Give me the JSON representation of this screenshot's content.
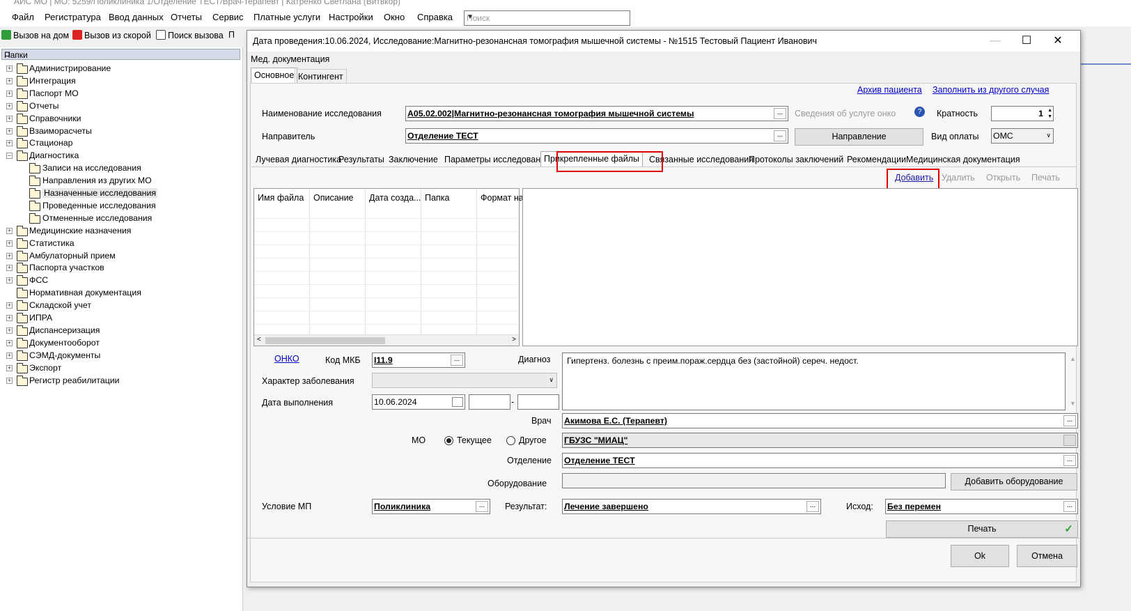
{
  "app": {
    "title": "АИС МО | МО: 5259/Поликлиника 1/Отделение ТЕСТ/Врач-терапевт | Катренко Светлана (Витвкор)"
  },
  "menu": [
    "Файл",
    "Регистратура",
    "Ввод данных",
    "Отчеты",
    "Сервис",
    "Платные услуги",
    "Настройки",
    "Окно",
    "Справка"
  ],
  "search": {
    "placeholder": "Поиск"
  },
  "toolbar": {
    "home_call": "Вызов на дом",
    "ambulance_call": "Вызов из скорой",
    "search_call": "Поиск вызова",
    "extra": "П"
  },
  "panel": {
    "title": "Папки",
    "pin": "⊐"
  },
  "tree": [
    {
      "label": "Администрирование",
      "level": 0,
      "exp": "+"
    },
    {
      "label": "Интеграция",
      "level": 0,
      "exp": "+"
    },
    {
      "label": "Паспорт МО",
      "level": 0,
      "exp": "+"
    },
    {
      "label": "Отчеты",
      "level": 0,
      "exp": "+"
    },
    {
      "label": "Справочники",
      "level": 0,
      "exp": "+"
    },
    {
      "label": "Взаиморасчеты",
      "level": 0,
      "exp": "+"
    },
    {
      "label": "Стационар",
      "level": 0,
      "exp": "+"
    },
    {
      "label": "Диагностика",
      "level": 0,
      "exp": "−"
    },
    {
      "label": "Записи на исследования",
      "level": 1,
      "exp": ""
    },
    {
      "label": "Направления из других МО",
      "level": 1,
      "exp": ""
    },
    {
      "label": "Назначенные исследования",
      "level": 1,
      "exp": "",
      "selected": true
    },
    {
      "label": "Проведенные исследования",
      "level": 1,
      "exp": ""
    },
    {
      "label": "Отмененные исследования",
      "level": 1,
      "exp": ""
    },
    {
      "label": "Медицинские назначения",
      "level": 0,
      "exp": "+"
    },
    {
      "label": "Статистика",
      "level": 0,
      "exp": "+"
    },
    {
      "label": "Амбулаторный прием",
      "level": 0,
      "exp": "+"
    },
    {
      "label": "Паспорта участков",
      "level": 0,
      "exp": "+"
    },
    {
      "label": "ФСС",
      "level": 0,
      "exp": "+"
    },
    {
      "label": "Нормативная документация",
      "level": 0,
      "exp": ""
    },
    {
      "label": "Складской учет",
      "level": 0,
      "exp": "+"
    },
    {
      "label": "ИПРА",
      "level": 0,
      "exp": "+"
    },
    {
      "label": "Диспансеризация",
      "level": 0,
      "exp": "+"
    },
    {
      "label": "Документооборот",
      "level": 0,
      "exp": "+"
    },
    {
      "label": "СЭМД-документы",
      "level": 0,
      "exp": "+"
    },
    {
      "label": "Экспорт",
      "level": 0,
      "exp": "+"
    },
    {
      "label": "Регистр реабилитации",
      "level": 0,
      "exp": "+"
    }
  ],
  "dialog": {
    "title": "Дата проведения:10.06.2024, Исследование:Магнитно-резонансная томография мышечной системы - №1515 Тестовый Пациент Иванович",
    "min": "—",
    "max": "☐",
    "close": "✕",
    "med_doc": "Мед. документация",
    "tabs": {
      "main": "Основное",
      "contingent": "Контингент"
    },
    "links": {
      "archive": "Архив пациента",
      "fill_from": "Заполнить из другого случая"
    },
    "research_label": "Наименование исследования",
    "research_value": "A05.02.002|Магнитно-резонансная томография мышечной системы",
    "onko_info": "Сведения об услуге онко",
    "multiplicity_label": "Кратность",
    "multiplicity_value": "1",
    "referrer_label": "Направитель",
    "referrer_value": "Отделение ТЕСТ",
    "referral_btn": "Направление",
    "pay_label": "Вид оплаты",
    "pay_value": "ОМС",
    "subtabs": [
      "Лучевая диагностика",
      "Результаты",
      "Заключение",
      "Параметры исследования",
      "Прикрепленные файлы",
      "Связанные исследования",
      "Протоколы заключений",
      "Рекомендации",
      "Медицинская документация"
    ],
    "file_actions": {
      "add": "Добавить",
      "delete": "Удалить",
      "open": "Открыть",
      "print": "Печать"
    },
    "grid_cols": [
      "Имя файла",
      "Описание",
      "Дата созда...",
      "Папка",
      "Формат на..."
    ],
    "onko": "ОНКО",
    "mkb_label": "Код МКБ",
    "mkb_value": "I11.9",
    "diag_label": "Диагноз",
    "diag_value": "Гипертенз. болезнь с преим.пораж.сердца без (застойной) сереч. недост.",
    "disease_char_label": "Характер заболевания",
    "exec_date_label": "Дата выполнения",
    "exec_date_value": "10.06.2024",
    "date_sep": "-",
    "doctor_label": "Врач",
    "doctor_value": "Акимова Е.С. (Терапевт)",
    "mo_label": "МО",
    "mo_current": "Текущее",
    "mo_other": "Другое",
    "mo_value": "ГБУЗС \"МИАЦ\"",
    "dept_label": "Отделение",
    "dept_value": "Отделение ТЕСТ",
    "equip_label": "Оборудование",
    "equip_add": "Добавить оборудование",
    "cond_label": "Условие МП",
    "cond_value": "Поликлиника",
    "result_label": "Результат:",
    "result_value": "Лечение завершено",
    "outcome_label": "Исход:",
    "outcome_value": "Без перемен",
    "print_btn": "Печать",
    "ok": "Ok",
    "cancel": "Отмена"
  },
  "colors": {
    "highlight": "#e00000",
    "link": "#0000cc",
    "panel_head": "#d6dbe9",
    "ok_check": "#2ea12e"
  }
}
